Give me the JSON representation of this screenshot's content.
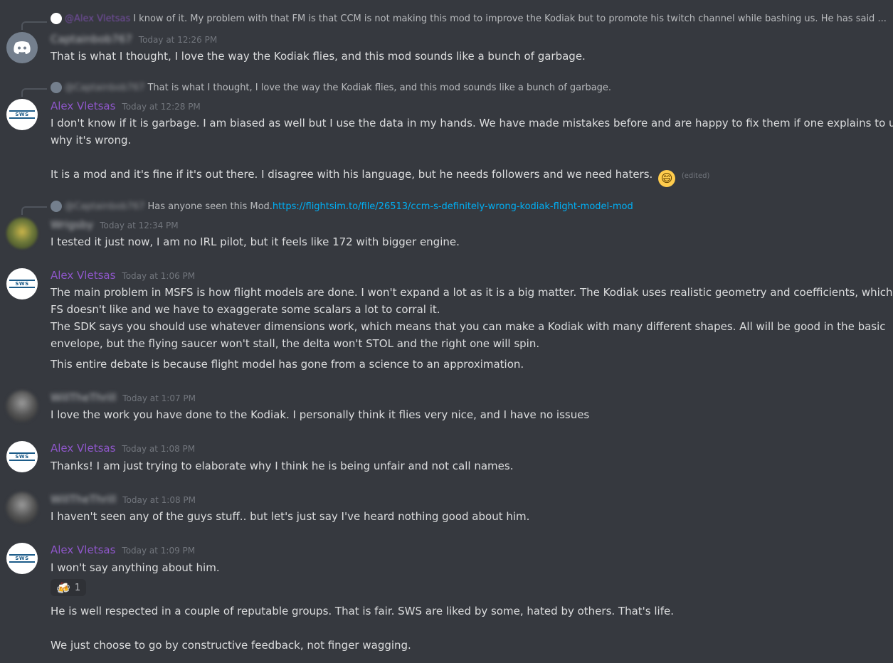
{
  "messages": [
    {
      "reply": {
        "author": "@Alex Vletsas",
        "text": "I know of it. My problem with that FM is that CCM is not making this mod to improve the Kodiak but to promote his twitch channel while bashing us. He has said ..."
      },
      "author": "Captainbob767",
      "time": "Today at 12:26 PM",
      "lines": [
        "That is what I thought, I love the way the Kodiak flies, and this mod sounds like a bunch of garbage."
      ]
    },
    {
      "reply": {
        "author": "@Captainbob767",
        "text": "That is what I thought, I love the way the Kodiak flies, and this mod sounds like a bunch of garbage."
      },
      "author": "Alex Vletsas",
      "time": "Today at 12:28 PM",
      "lines": [
        "I don't know if it is garbage. I am biased as well but I use the data in my hands. We have made mistakes before and are happy to fix them if one explains to us",
        "why it's wrong.",
        "It is a mod and it's fine if it's out there. I disagree with his language, but he needs followers and we need haters."
      ],
      "emoji": "😄",
      "edited": "(edited)"
    },
    {
      "reply": {
        "author": "@Captainbob767",
        "text": "Has anyone seen this Mod.",
        "link": "https://flightsim.to/file/26513/ccm-s-definitely-wrong-kodiak-flight-model-mod"
      },
      "author": "Wrigsby",
      "time": "Today at 12:34 PM",
      "lines": [
        "I tested it just now, I am no IRL pilot, but it feels like 172 with bigger engine."
      ]
    },
    {
      "author": "Alex Vletsas",
      "time": "Today at 1:06 PM",
      "lines": [
        "The main problem in MSFS is how flight models are done. I won't expand a lot as it is a big matter. The Kodiak uses realistic geometry and coefficients, which",
        "FS doesn't like and we have to exaggerate some scalars a lot to corral it.",
        "The SDK says you should use whatever dimensions work, which means that you can make a Kodiak with many different shapes. All will be good in the basic",
        "envelope, but the flying saucer won't stall, the delta won't STOL and the right one will spin.",
        "This entire debate is because flight model has gone from a science to an approximation."
      ]
    },
    {
      "author": "WillTheThrill",
      "time": "Today at 1:07 PM",
      "lines": [
        "I love the work you have done to the Kodiak. I personally think it flies very nice, and I have no issues"
      ]
    },
    {
      "author": "Alex Vletsas",
      "time": "Today at 1:08 PM",
      "lines": [
        "Thanks! I am just trying to elaborate why I think he is being unfair and not call names."
      ]
    },
    {
      "author": "WillTheThrill",
      "time": "Today at 1:08 PM",
      "lines": [
        "I haven't seen any of the guys stuff.. but let's just say I've heard nothing good about him."
      ]
    },
    {
      "author": "Alex Vletsas",
      "time": "Today at 1:09 PM",
      "lines": [
        "I won't say anything about him.",
        "He is well respected in a couple of reputable groups. That is fair. SWS are liked by some, hated by others. That's life.",
        "We just choose to go by constructive feedback, not finger wagging."
      ],
      "reaction": {
        "emoji": "🍻",
        "count": "1"
      }
    }
  ],
  "logo_text": "SWS",
  "colors": {
    "background": "#36393f",
    "author": "#8e56c9",
    "link": "#00aff4",
    "text": "#dcddde"
  }
}
